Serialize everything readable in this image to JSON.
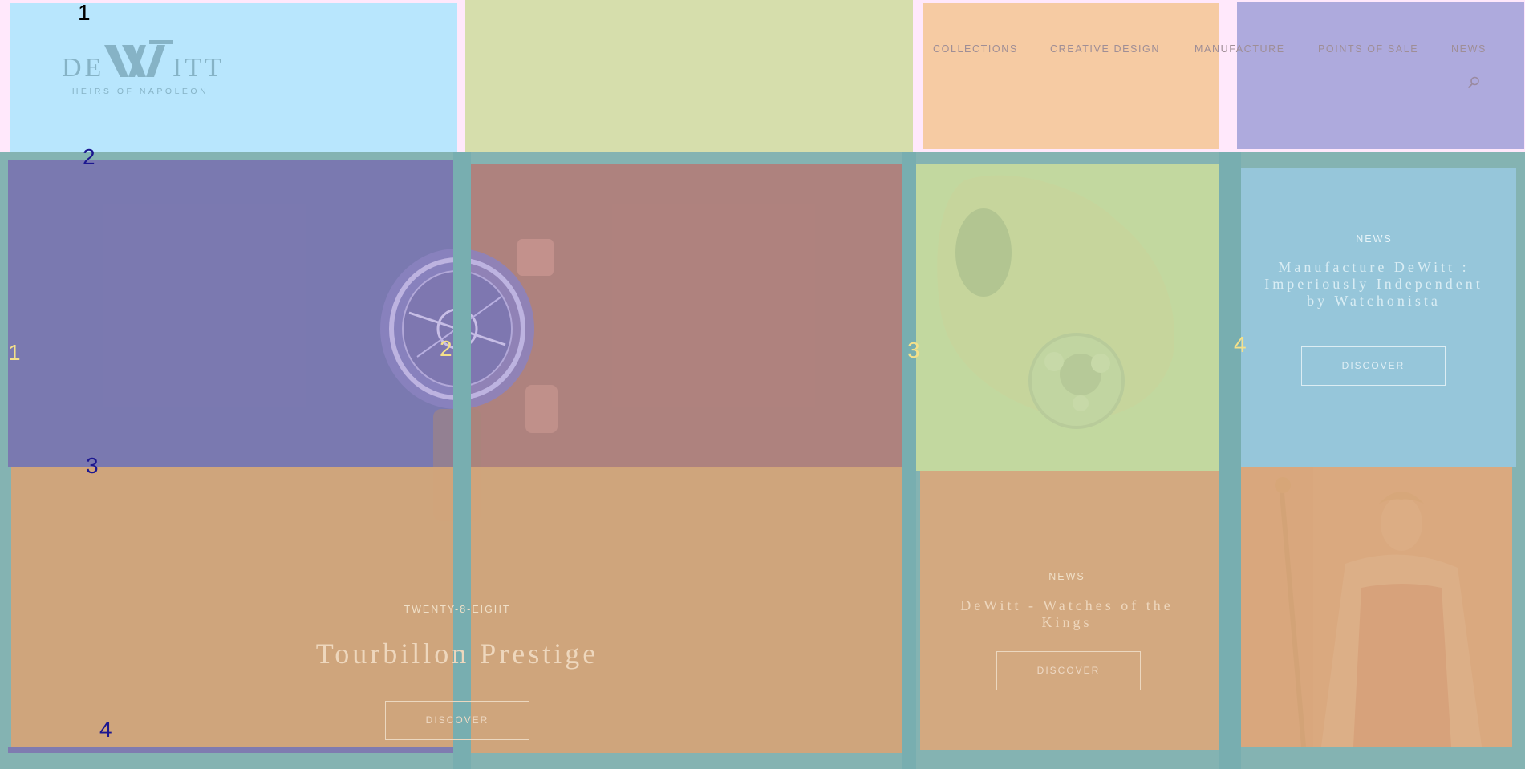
{
  "logo": {
    "wordmark_left": "DE",
    "wordmark_right": "ITT",
    "tagline": "HEIRS OF NAPOLEON",
    "color": "#86b3c6"
  },
  "nav": {
    "items": [
      "COLLECTIONS",
      "CREATIVE DESIGN",
      "MANUFACTURE",
      "POINTS OF SALE",
      "NEWS"
    ],
    "search_icon": "search-icon"
  },
  "region_numbers": {
    "header": [
      "1"
    ],
    "left_column": [
      "2",
      "3",
      "4"
    ],
    "columns": [
      "1",
      "2",
      "3",
      "4"
    ]
  },
  "features": {
    "main": {
      "kicker": "TWENTY-8-EIGHT",
      "title": "Tourbillon Prestige",
      "button": "DISCOVER"
    },
    "news_middle": {
      "kicker": "NEWS",
      "title": "DeWitt - Watches of the Kings",
      "button": "DISCOVER"
    },
    "news_right": {
      "kicker": "NEWS",
      "title": "Manufacture DeWitt : Imperiously Independent by Watchonista",
      "button": "DISCOVER"
    }
  },
  "colors": {
    "header_blue": "#b8e6fd",
    "header_olive": "#d6deac",
    "header_orange": "#f6cba3",
    "header_purple": "#aeaadd",
    "teal": "#84b3b2",
    "overlay_purple": "#7a74b0",
    "overlay_red": "#b27e7a",
    "overlay_orange": "#d2a47a",
    "overlay_green": "#c4daa0",
    "overlay_blue": "#96c6da"
  }
}
